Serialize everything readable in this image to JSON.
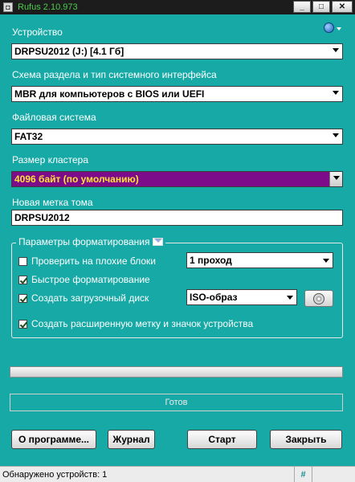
{
  "window": {
    "title": "Rufus 2.10.973",
    "minimize": "_",
    "maximize": "□",
    "close": "✕"
  },
  "device": {
    "label": "Устройство",
    "value": "DRPSU2012 (J:) [4.1 Гб]"
  },
  "partition": {
    "label": "Схема раздела и тип системного интерфейса",
    "value": "MBR для компьютеров с BIOS или UEFI"
  },
  "filesystem": {
    "label": "Файловая система",
    "value": "FAT32"
  },
  "cluster": {
    "label": "Размер кластера",
    "value": "4096 байт (по умолчанию)"
  },
  "volume": {
    "label": "Новая метка тома",
    "value": "DRPSU2012"
  },
  "format_options": {
    "title": "Параметры форматирования",
    "bad_blocks": {
      "label": "Проверить на плохие блоки",
      "checked": false,
      "passes": "1 проход"
    },
    "quick_format": {
      "label": "Быстрое форматирование",
      "checked": true
    },
    "bootable": {
      "label": "Создать загрузочный диск",
      "checked": true,
      "image_type": "ISO-образ"
    },
    "extended_label": {
      "label": "Создать расширенную метку и значок устройства",
      "checked": true
    }
  },
  "progress": {
    "value": 0
  },
  "status": {
    "text": "Готов"
  },
  "buttons": {
    "about": "О программе...",
    "log": "Журнал",
    "start": "Старт",
    "close": "Закрыть"
  },
  "statusbar": {
    "devices": "Обнаружено устройств: 1",
    "hash": "#"
  },
  "colors": {
    "background": "#16a9a6",
    "cluster_bg": "#7d0c8b",
    "cluster_text": "#ffe23a"
  },
  "icons": {
    "language": "globe-icon",
    "email": "envelope-icon",
    "iso": "disc-icon"
  }
}
